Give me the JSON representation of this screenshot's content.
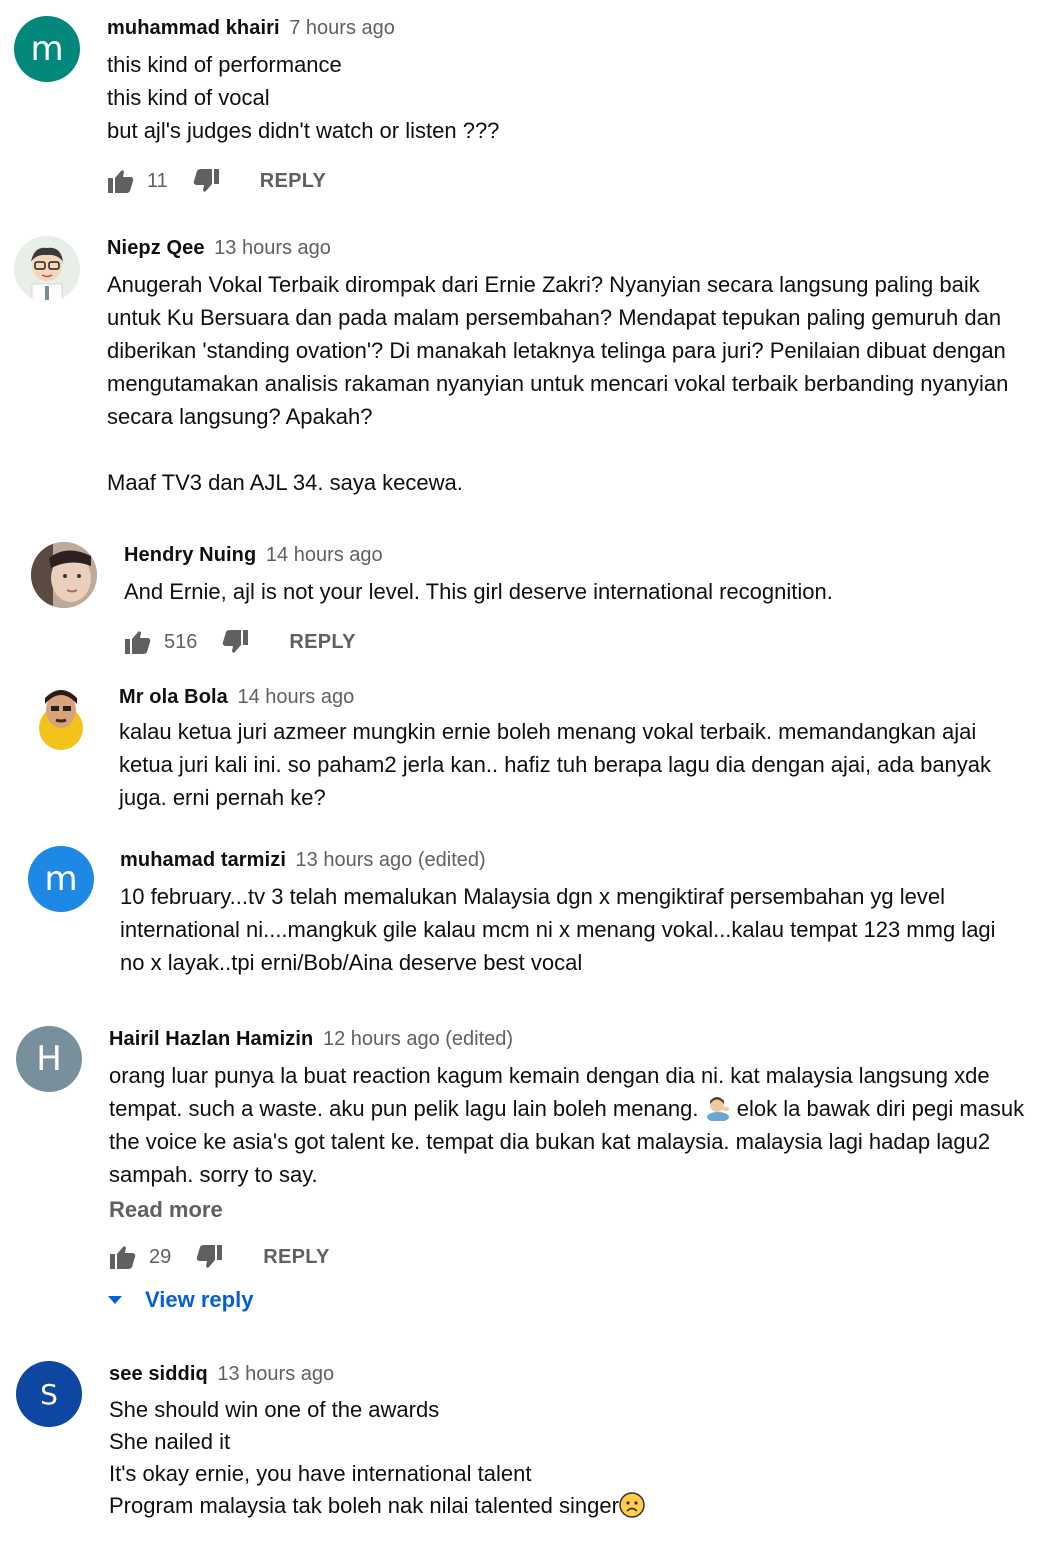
{
  "comments": [
    {
      "author": "muhammad khairi",
      "time": "7 hours ago",
      "avatar_letter": "m",
      "avatar_color": "#00897b",
      "text": "this kind of performance\nthis kind of vocal\nbut ajl's judges didn't watch or listen ???",
      "likes": "11",
      "reply_label": "REPLY"
    },
    {
      "author": "Niepz Qee",
      "time": "13 hours ago",
      "text": "Anugerah Vokal Terbaik dirompak dari Ernie Zakri? Nyanyian secara langsung paling baik untuk Ku Bersuara dan pada malam persembahan? Mendapat tepukan paling gemuruh dan diberikan 'standing ovation'? Di manakah letaknya telinga para juri? Penilaian dibuat dengan mengutamakan analisis rakaman nyanyian untuk mencari vokal terbaik berbanding nyanyian secara langsung? Apakah?",
      "text2": "Maaf TV3 dan AJL 34. saya kecewa."
    },
    {
      "author": "Hendry Nuing",
      "time": "14 hours ago",
      "text": "And Ernie, ajl is not your level. This girl deserve international recognition.",
      "likes": "516",
      "reply_label": "REPLY"
    },
    {
      "author": "Mr ola Bola",
      "time": "14 hours ago",
      "text": "kalau ketua juri azmeer mungkin ernie boleh menang vokal terbaik. memandangkan ajai ketua juri kali ini. so paham2 jerla kan.. hafiz tuh berapa lagu dia dengan ajai, ada banyak juga. erni pernah ke?"
    },
    {
      "author": "muhamad tarmizi",
      "time": "13 hours ago (edited)",
      "avatar_letter": "m",
      "avatar_color": "#1e88e5",
      "text": "10 february...tv 3 telah memalukan Malaysia dgn x mengiktiraf persembahan yg level international ni....mangkuk gile kalau mcm ni x menang vokal...kalau tempat 123 mmg lagi no x layak..tpi erni/Bob/Aina deserve  best vocal"
    },
    {
      "author": "Hairil Hazlan Hamizin",
      "time": "12 hours ago (edited)",
      "avatar_letter": "H",
      "avatar_color": "#78909c",
      "text_a": "orang luar punya la buat reaction kagum kemain dengan dia ni. kat malaysia langsung xde tempat. such a waste. aku pun pelik lagu lain boleh menang.",
      "text_b": "elok la bawak diri pegi masuk the voice ke asia's got talent ke. tempat dia bukan kat malaysia. malaysia lagi hadap lagu2 sampah. sorry to say.",
      "read_more": "Read more",
      "likes": "29",
      "reply_label": "REPLY",
      "view_reply": "View reply"
    },
    {
      "author": "see siddiq",
      "time": "13 hours ago",
      "avatar_letter": "S",
      "avatar_color": "#0d47a1",
      "text": "She should win one of the awards\nShe nailed it\nIt's okay ernie,  you have international talent\nProgram malaysia tak boleh nak nilai talented singer"
    }
  ]
}
